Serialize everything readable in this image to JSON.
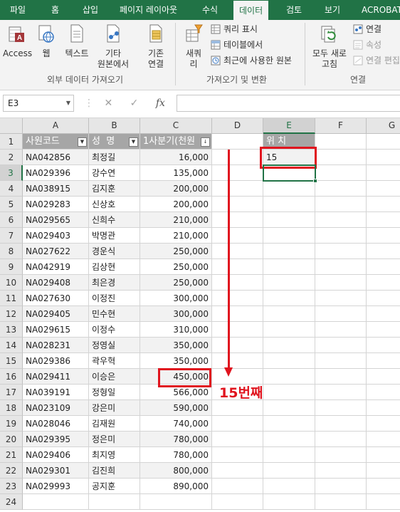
{
  "ribbon_tabs": [
    "파일",
    "홈",
    "삽입",
    "페이지 레이아웃",
    "수식",
    "데이터",
    "검토",
    "보기",
    "ACROBAT"
  ],
  "active_tab": "데이터",
  "groups": {
    "external": {
      "label": "외부 데이터 가져오기",
      "access": "Access",
      "web": "웹",
      "text": "텍스트",
      "other_1": "기타",
      "other_2": "원본에서",
      "existing_1": "기존",
      "existing_2": "연결"
    },
    "transform": {
      "label": "가져오기 및 변환",
      "new_query_1": "새쿼",
      "new_query_2": "리",
      "show_queries": "쿼리 표시",
      "from_table": "테이블에서",
      "recent_sources": "최근에 사용한 원본"
    },
    "connections": {
      "label": "연결",
      "refresh_1": "모두 새로",
      "refresh_2": "고침",
      "connections": "연결",
      "properties": "속성",
      "edit_links": "연결 편집"
    }
  },
  "formula_bar": {
    "name_box": "E3",
    "fx": "fx",
    "value": ""
  },
  "columns": [
    "A",
    "B",
    "C",
    "D",
    "E",
    "F",
    "G"
  ],
  "headers": {
    "code": "사원코드",
    "name": "성  명",
    "q1": "1사분기(천원",
    "pos": "위 치"
  },
  "rows": [
    {
      "code": "NA042856",
      "name": "최정길",
      "q1": "16,000"
    },
    {
      "code": "NA029396",
      "name": "강수연",
      "q1": "135,000"
    },
    {
      "code": "NA038915",
      "name": "김지훈",
      "q1": "200,000"
    },
    {
      "code": "NA029283",
      "name": "신상호",
      "q1": "200,000"
    },
    {
      "code": "NA029565",
      "name": "신희수",
      "q1": "210,000"
    },
    {
      "code": "NA029403",
      "name": "박명관",
      "q1": "210,000"
    },
    {
      "code": "NA027622",
      "name": "경운식",
      "q1": "250,000"
    },
    {
      "code": "NA042919",
      "name": "김상현",
      "q1": "250,000"
    },
    {
      "code": "NA029408",
      "name": "최은경",
      "q1": "250,000"
    },
    {
      "code": "NA027630",
      "name": "이정진",
      "q1": "300,000"
    },
    {
      "code": "NA029405",
      "name": "민수현",
      "q1": "300,000"
    },
    {
      "code": "NA029615",
      "name": "이정수",
      "q1": "310,000"
    },
    {
      "code": "NA028231",
      "name": "정영실",
      "q1": "350,000"
    },
    {
      "code": "NA029386",
      "name": "곽우혁",
      "q1": "350,000"
    },
    {
      "code": "NA029411",
      "name": "이승은",
      "q1": "450,000"
    },
    {
      "code": "NA039191",
      "name": "정형일",
      "q1": "566,000"
    },
    {
      "code": "NA023109",
      "name": "강은미",
      "q1": "590,000"
    },
    {
      "code": "NA028046",
      "name": "김재원",
      "q1": "740,000"
    },
    {
      "code": "NA029395",
      "name": "정은미",
      "q1": "780,000"
    },
    {
      "code": "NA029406",
      "name": "최지영",
      "q1": "780,000"
    },
    {
      "code": "NA029301",
      "name": "김진희",
      "q1": "800,000"
    },
    {
      "code": "NA029993",
      "name": "공지훈",
      "q1": "890,000"
    }
  ],
  "row_numbers": [
    "1",
    "2",
    "3",
    "4",
    "5",
    "6",
    "7",
    "8",
    "9",
    "10",
    "11",
    "12",
    "13",
    "14",
    "15",
    "16",
    "17",
    "18",
    "19",
    "20",
    "21",
    "22",
    "23",
    "24"
  ],
  "result_value": "15",
  "annotation": "15번째",
  "colors": {
    "excel_green": "#217346",
    "highlight_red": "#e0141e",
    "header_gray": "#a6a6a6",
    "band_gray": "#f2f2f2"
  }
}
